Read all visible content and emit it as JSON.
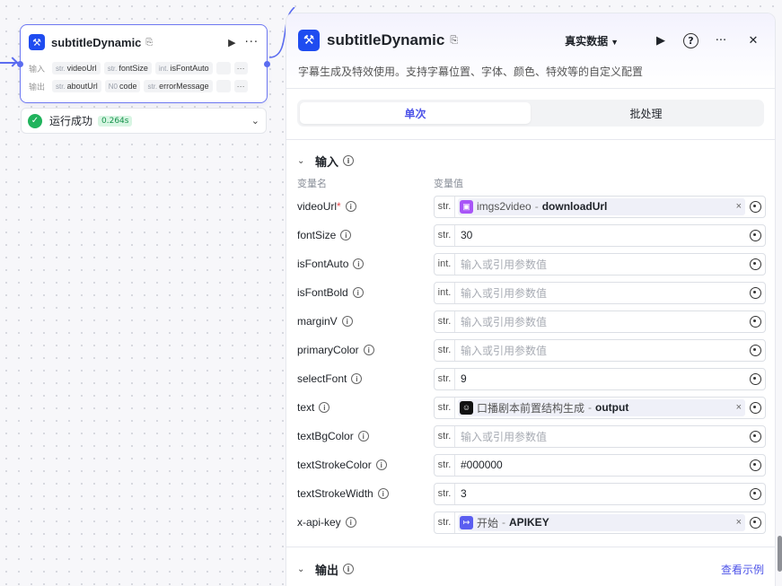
{
  "node": {
    "title": "subtitleDynamic",
    "tag": "⎘",
    "run_icon": "▶",
    "more": "···",
    "input_label": "输入",
    "output_label": "输出",
    "inputs": [
      {
        "type": "str.",
        "name": "videoUrl"
      },
      {
        "type": "str.",
        "name": "fontSize"
      },
      {
        "type": "int.",
        "name": "isFontAuto"
      }
    ],
    "outputs": [
      {
        "type": "str.",
        "name": "aboutUrl"
      },
      {
        "type": "N0",
        "name": "code"
      },
      {
        "type": "str.",
        "name": "errorMessage"
      }
    ],
    "more_chip": "···"
  },
  "run_status": {
    "text": "运行成功",
    "time": "0.264s",
    "check": "✓",
    "chevron": "⌄"
  },
  "panel": {
    "title": "subtitleDynamic",
    "tag": "⎘",
    "data_source": "真实数据",
    "data_caret": "▼",
    "run_icon": "▶",
    "help_icon": "?",
    "more_icon": "···",
    "close_icon": "✕",
    "description": "字幕生成及特效使用。支持字幕位置、字体、颜色、特效等的自定义配置",
    "tabs": [
      {
        "label": "单次",
        "active": true
      },
      {
        "label": "批处理",
        "active": false
      }
    ],
    "input_section": {
      "title": "输入",
      "chevron": "⌄",
      "info": "i",
      "col_name": "变量名",
      "col_value": "变量值"
    },
    "rows": [
      {
        "name": "videoUrl",
        "required": "*",
        "type": "str.",
        "ref_src": "imgs2video",
        "ref_sep": "-",
        "ref_out": "downloadUrl",
        "ref_clear": "×",
        "ref_color": "#a855f7",
        "ref_glyph": "▣"
      },
      {
        "name": "fontSize",
        "type": "str.",
        "value": "30"
      },
      {
        "name": "isFontAuto",
        "type": "int.",
        "placeholder": "输入或引用参数值"
      },
      {
        "name": "isFontBold",
        "type": "int.",
        "placeholder": "输入或引用参数值"
      },
      {
        "name": "marginV",
        "type": "str.",
        "placeholder": "输入或引用参数值"
      },
      {
        "name": "primaryColor",
        "type": "str.",
        "placeholder": "输入或引用参数值"
      },
      {
        "name": "selectFont",
        "type": "str.",
        "value": "9"
      },
      {
        "name": "text",
        "type": "str.",
        "ref_src": "口播剧本前置结构生成",
        "ref_sep": "-",
        "ref_out": "output",
        "ref_clear": "×",
        "ref_color": "#111111",
        "ref_glyph": "☺"
      },
      {
        "name": "textBgColor",
        "type": "str.",
        "placeholder": "输入或引用参数值"
      },
      {
        "name": "textStrokeColor",
        "type": "str.",
        "value": "#000000"
      },
      {
        "name": "textStrokeWidth",
        "type": "str.",
        "value": "3"
      },
      {
        "name": "x-api-key",
        "type": "str.",
        "ref_src": "开始",
        "ref_sep": "-",
        "ref_out": "APIKEY",
        "ref_clear": "×",
        "ref_color": "#5b5ef0",
        "ref_glyph": "↦"
      }
    ],
    "output_section": {
      "title": "输出",
      "chevron": "⌄",
      "info": "i",
      "link": "查看示例"
    }
  },
  "colors": {
    "accent": "#4d53e8",
    "node_border": "#6d78f2",
    "success": "#20b35c",
    "brand_icon": "#1f4cf0"
  }
}
